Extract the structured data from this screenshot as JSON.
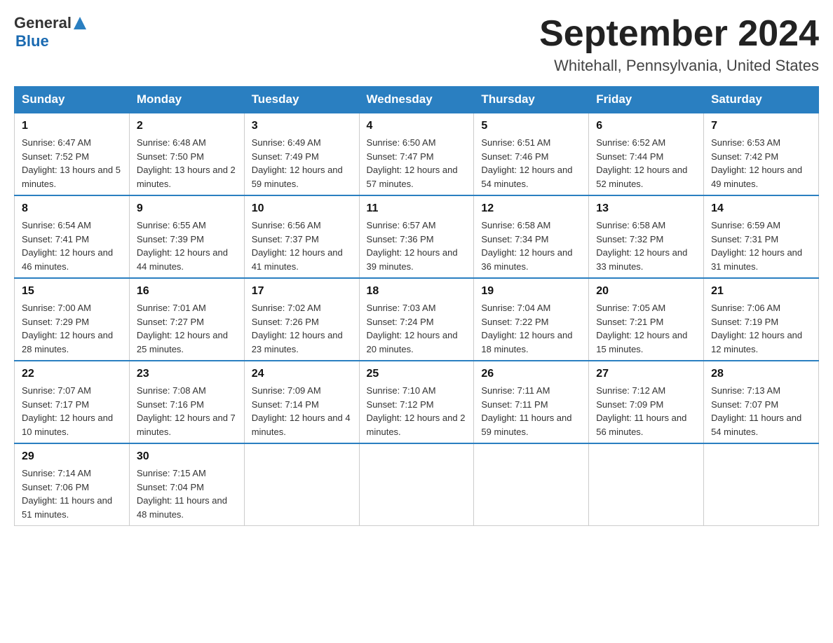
{
  "header": {
    "logo_general": "General",
    "logo_blue": "Blue",
    "month_title": "September 2024",
    "location": "Whitehall, Pennsylvania, United States"
  },
  "days_of_week": [
    "Sunday",
    "Monday",
    "Tuesday",
    "Wednesday",
    "Thursday",
    "Friday",
    "Saturday"
  ],
  "weeks": [
    [
      {
        "day": "1",
        "sunrise": "Sunrise: 6:47 AM",
        "sunset": "Sunset: 7:52 PM",
        "daylight": "Daylight: 13 hours and 5 minutes."
      },
      {
        "day": "2",
        "sunrise": "Sunrise: 6:48 AM",
        "sunset": "Sunset: 7:50 PM",
        "daylight": "Daylight: 13 hours and 2 minutes."
      },
      {
        "day": "3",
        "sunrise": "Sunrise: 6:49 AM",
        "sunset": "Sunset: 7:49 PM",
        "daylight": "Daylight: 12 hours and 59 minutes."
      },
      {
        "day": "4",
        "sunrise": "Sunrise: 6:50 AM",
        "sunset": "Sunset: 7:47 PM",
        "daylight": "Daylight: 12 hours and 57 minutes."
      },
      {
        "day": "5",
        "sunrise": "Sunrise: 6:51 AM",
        "sunset": "Sunset: 7:46 PM",
        "daylight": "Daylight: 12 hours and 54 minutes."
      },
      {
        "day": "6",
        "sunrise": "Sunrise: 6:52 AM",
        "sunset": "Sunset: 7:44 PM",
        "daylight": "Daylight: 12 hours and 52 minutes."
      },
      {
        "day": "7",
        "sunrise": "Sunrise: 6:53 AM",
        "sunset": "Sunset: 7:42 PM",
        "daylight": "Daylight: 12 hours and 49 minutes."
      }
    ],
    [
      {
        "day": "8",
        "sunrise": "Sunrise: 6:54 AM",
        "sunset": "Sunset: 7:41 PM",
        "daylight": "Daylight: 12 hours and 46 minutes."
      },
      {
        "day": "9",
        "sunrise": "Sunrise: 6:55 AM",
        "sunset": "Sunset: 7:39 PM",
        "daylight": "Daylight: 12 hours and 44 minutes."
      },
      {
        "day": "10",
        "sunrise": "Sunrise: 6:56 AM",
        "sunset": "Sunset: 7:37 PM",
        "daylight": "Daylight: 12 hours and 41 minutes."
      },
      {
        "day": "11",
        "sunrise": "Sunrise: 6:57 AM",
        "sunset": "Sunset: 7:36 PM",
        "daylight": "Daylight: 12 hours and 39 minutes."
      },
      {
        "day": "12",
        "sunrise": "Sunrise: 6:58 AM",
        "sunset": "Sunset: 7:34 PM",
        "daylight": "Daylight: 12 hours and 36 minutes."
      },
      {
        "day": "13",
        "sunrise": "Sunrise: 6:58 AM",
        "sunset": "Sunset: 7:32 PM",
        "daylight": "Daylight: 12 hours and 33 minutes."
      },
      {
        "day": "14",
        "sunrise": "Sunrise: 6:59 AM",
        "sunset": "Sunset: 7:31 PM",
        "daylight": "Daylight: 12 hours and 31 minutes."
      }
    ],
    [
      {
        "day": "15",
        "sunrise": "Sunrise: 7:00 AM",
        "sunset": "Sunset: 7:29 PM",
        "daylight": "Daylight: 12 hours and 28 minutes."
      },
      {
        "day": "16",
        "sunrise": "Sunrise: 7:01 AM",
        "sunset": "Sunset: 7:27 PM",
        "daylight": "Daylight: 12 hours and 25 minutes."
      },
      {
        "day": "17",
        "sunrise": "Sunrise: 7:02 AM",
        "sunset": "Sunset: 7:26 PM",
        "daylight": "Daylight: 12 hours and 23 minutes."
      },
      {
        "day": "18",
        "sunrise": "Sunrise: 7:03 AM",
        "sunset": "Sunset: 7:24 PM",
        "daylight": "Daylight: 12 hours and 20 minutes."
      },
      {
        "day": "19",
        "sunrise": "Sunrise: 7:04 AM",
        "sunset": "Sunset: 7:22 PM",
        "daylight": "Daylight: 12 hours and 18 minutes."
      },
      {
        "day": "20",
        "sunrise": "Sunrise: 7:05 AM",
        "sunset": "Sunset: 7:21 PM",
        "daylight": "Daylight: 12 hours and 15 minutes."
      },
      {
        "day": "21",
        "sunrise": "Sunrise: 7:06 AM",
        "sunset": "Sunset: 7:19 PM",
        "daylight": "Daylight: 12 hours and 12 minutes."
      }
    ],
    [
      {
        "day": "22",
        "sunrise": "Sunrise: 7:07 AM",
        "sunset": "Sunset: 7:17 PM",
        "daylight": "Daylight: 12 hours and 10 minutes."
      },
      {
        "day": "23",
        "sunrise": "Sunrise: 7:08 AM",
        "sunset": "Sunset: 7:16 PM",
        "daylight": "Daylight: 12 hours and 7 minutes."
      },
      {
        "day": "24",
        "sunrise": "Sunrise: 7:09 AM",
        "sunset": "Sunset: 7:14 PM",
        "daylight": "Daylight: 12 hours and 4 minutes."
      },
      {
        "day": "25",
        "sunrise": "Sunrise: 7:10 AM",
        "sunset": "Sunset: 7:12 PM",
        "daylight": "Daylight: 12 hours and 2 minutes."
      },
      {
        "day": "26",
        "sunrise": "Sunrise: 7:11 AM",
        "sunset": "Sunset: 7:11 PM",
        "daylight": "Daylight: 11 hours and 59 minutes."
      },
      {
        "day": "27",
        "sunrise": "Sunrise: 7:12 AM",
        "sunset": "Sunset: 7:09 PM",
        "daylight": "Daylight: 11 hours and 56 minutes."
      },
      {
        "day": "28",
        "sunrise": "Sunrise: 7:13 AM",
        "sunset": "Sunset: 7:07 PM",
        "daylight": "Daylight: 11 hours and 54 minutes."
      }
    ],
    [
      {
        "day": "29",
        "sunrise": "Sunrise: 7:14 AM",
        "sunset": "Sunset: 7:06 PM",
        "daylight": "Daylight: 11 hours and 51 minutes."
      },
      {
        "day": "30",
        "sunrise": "Sunrise: 7:15 AM",
        "sunset": "Sunset: 7:04 PM",
        "daylight": "Daylight: 11 hours and 48 minutes."
      },
      null,
      null,
      null,
      null,
      null
    ]
  ]
}
